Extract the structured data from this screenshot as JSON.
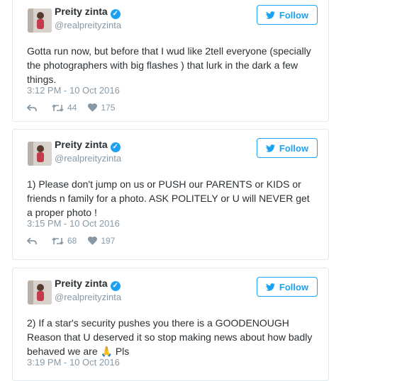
{
  "tweets": [
    {
      "name": "Preity zinta",
      "handle": "@realpreityzinta",
      "follow_label": "Follow",
      "text": "Gotta run now, but before that I wud like 2tell everyone (specially the photographers with big flashes ) that lurk in the dark a few things.",
      "timestamp": "3:12 PM - 10 Oct 2016",
      "retweets": "44",
      "likes": "175"
    },
    {
      "name": "Preity zinta",
      "handle": "@realpreityzinta",
      "follow_label": "Follow",
      "text": "1) Please don't jump on us or PUSH our PARENTS or KIDS or friends n family for a photo. ASK POLITELY or U will NEVER get a proper photo !",
      "timestamp": "3:15 PM - 10 Oct 2016",
      "retweets": "68",
      "likes": "197"
    },
    {
      "name": "Preity zinta",
      "handle": "@realpreityzinta",
      "follow_label": "Follow",
      "text": "2) If a star's security pushes you there is a GOODENOUGH Reason that U deserved it so stop making news about how badly behaved we are 🙏 Pls",
      "timestamp": "3:19 PM - 10 Oct 2016",
      "retweets": "",
      "likes": ""
    }
  ],
  "icons": {
    "verified": "verified-badge-icon",
    "bird": "twitter-bird-icon",
    "reply": "reply-icon",
    "retweet": "retweet-icon",
    "like": "heart-icon"
  },
  "colors": {
    "accent": "#1da1f2",
    "text": "#292f33",
    "muted": "#8899a6",
    "border": "#e1e8ed"
  }
}
